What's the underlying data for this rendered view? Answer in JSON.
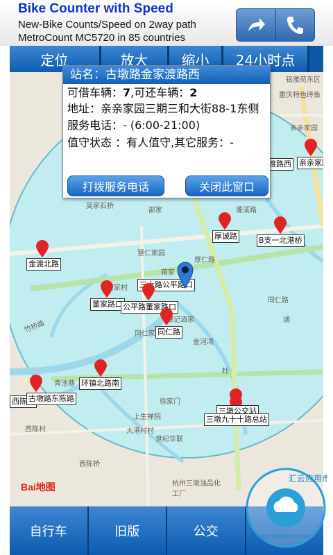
{
  "banner": {
    "title": "Bike Counter with Speed",
    "line1": "New-Bike Counts/Speed on 2way path",
    "line2": "MetroCount MC5720 in 85 countries",
    "share_icon": "share-arrow-icon",
    "phone_icon": "phone-icon"
  },
  "toolbar": {
    "locate": "定位",
    "zoom_in": "放大",
    "zoom_out": "缩小",
    "hours24": "24小时点"
  },
  "popup": {
    "title": "站名：古墩路金家渡路西",
    "borrow_label": "可借车辆：",
    "borrow_value": "7",
    "return_label": ",可还车辆：",
    "return_value": "2",
    "address": "地址：亲亲家园三期三和大街88-1东侧",
    "phone": "服务电话：- (6:00-21:00)",
    "status": "值守状态 ：有人值守,其它服务：-",
    "call_button": "打拨服务电话",
    "close_button": "关闭此窗口"
  },
  "markers": [
    {
      "label": "金渡北路"
    },
    {
      "label": "董家路口"
    },
    {
      "label": "三士路公平路口"
    },
    {
      "label": "公平路董家路口"
    },
    {
      "label": "同仁路"
    },
    {
      "label": "厚诚路"
    },
    {
      "label": "B支一北港桥"
    },
    {
      "label": "环镇北路南"
    },
    {
      "label": "西陈路"
    },
    {
      "label": "古墩路东陈路"
    },
    {
      "label": "三墩九十十路总站"
    },
    {
      "label": "三墩公交站"
    },
    {
      "label": "渡路西"
    },
    {
      "label": "亲亲家园"
    }
  ],
  "map_labels": {
    "a": "吴家石桥",
    "b": "部家",
    "c": "慧仁家园",
    "d": "蒋家",
    "e": "董家村",
    "f": "厚仁路",
    "g": "蓬溪路",
    "h": "同仁路",
    "i": "金河湾",
    "j": "徐家门",
    "k": "上生禅院",
    "l": "世纪华联",
    "m": "大港村村",
    "n": "西陈村",
    "o": "西陈桥",
    "p": "杭州三墩油品化工厂",
    "q": "竹桥路",
    "r": "青池巷",
    "s": "镖记酒家",
    "t": "重庆特色砖鱼",
    "u": "亲亲家园",
    "v": "铭雅苑东区",
    "w": "通",
    "x": "同仁家园",
    "y": "杜"
  },
  "tabs": {
    "bike": "自行车",
    "old": "旧版",
    "bus": "公交",
    "more": ""
  },
  "watermark": {
    "text": "汇云应用市场",
    "url": "app.hicloud.com"
  },
  "baidu": {
    "logo": "Bai地图"
  }
}
